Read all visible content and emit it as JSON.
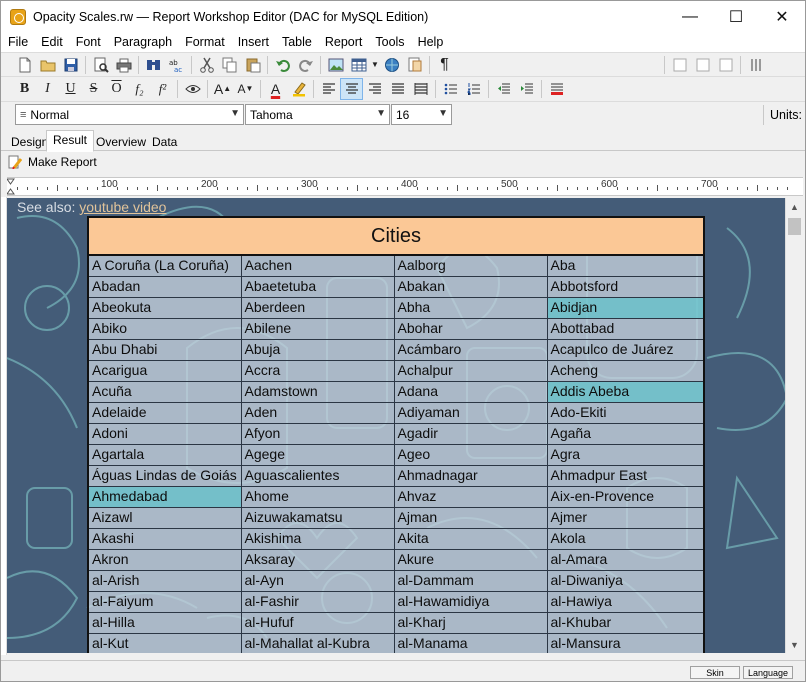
{
  "window": {
    "title": "Opacity Scales.rw — Report Workshop Editor (DAC for MySQL Edition)",
    "controls": {
      "minimize": "—",
      "maximize": "☐",
      "close": "✕"
    }
  },
  "menu": [
    "File",
    "Edit",
    "Font",
    "Paragraph",
    "Format",
    "Insert",
    "Table",
    "Report",
    "Tools",
    "Help"
  ],
  "toolbar1": {
    "icons": [
      "new-document-icon",
      "open-folder-icon",
      "save-icon",
      "print-preview-icon",
      "print-icon",
      "find-icon",
      "spellcheck-icon",
      "cut-icon",
      "copy-icon",
      "paste-icon",
      "undo-icon",
      "redo-icon",
      "insert-picture-icon",
      "insert-table-icon",
      "insert-hyperlink-icon",
      "insert-object-icon",
      "paragraph-marks-icon",
      "page-layout-icon",
      "page-layout2-icon",
      "page-layout3-icon",
      "page-layout4-icon",
      "vertical-text-icon"
    ]
  },
  "toolbar2": {
    "bold": "B",
    "italic": "I",
    "underline": "U",
    "strikethrough": "S",
    "overline": "O",
    "subscript": "f₂",
    "superscript": "f²",
    "font_grow": "A",
    "font_shrink": "A",
    "font_color": "A"
  },
  "formatbar": {
    "style": "Normal",
    "font": "Tahoma",
    "size": "16",
    "units_label": "Units:"
  },
  "tabs": [
    {
      "label": "Design",
      "active": false
    },
    {
      "label": "Result",
      "active": true
    },
    {
      "label": "Overview",
      "active": false
    },
    {
      "label": "Data",
      "active": false
    }
  ],
  "make_report": "Make Report",
  "ruler": {
    "labels": [
      "100",
      "200",
      "300",
      "400",
      "500",
      "600",
      "700"
    ]
  },
  "document": {
    "see_also_prefix": "See also:",
    "see_also_link": "youtube video",
    "background_color": "#445c78",
    "highlight_color": "#78c8d0",
    "table": {
      "title": "Cities",
      "rows": [
        [
          {
            "t": "A Coruña (La Coruña)"
          },
          {
            "t": "Aachen"
          },
          {
            "t": "Aalborg"
          },
          {
            "t": "Aba"
          }
        ],
        [
          {
            "t": "Abadan"
          },
          {
            "t": "Abaetetuba"
          },
          {
            "t": "Abakan"
          },
          {
            "t": "Abbotsford"
          }
        ],
        [
          {
            "t": "Abeokuta"
          },
          {
            "t": "Aberdeen"
          },
          {
            "t": "Abha"
          },
          {
            "t": "Abidjan",
            "hl": true
          }
        ],
        [
          {
            "t": "Abiko"
          },
          {
            "t": "Abilene"
          },
          {
            "t": "Abohar"
          },
          {
            "t": "Abottabad"
          }
        ],
        [
          {
            "t": "Abu Dhabi"
          },
          {
            "t": "Abuja"
          },
          {
            "t": "Acámbaro"
          },
          {
            "t": "Acapulco de Juárez"
          }
        ],
        [
          {
            "t": "Acarigua"
          },
          {
            "t": "Accra"
          },
          {
            "t": "Achalpur"
          },
          {
            "t": "Acheng"
          }
        ],
        [
          {
            "t": "Acuña"
          },
          {
            "t": "Adamstown"
          },
          {
            "t": "Adana"
          },
          {
            "t": "Addis Abeba",
            "hl": true
          }
        ],
        [
          {
            "t": "Adelaide"
          },
          {
            "t": "Aden"
          },
          {
            "t": "Adiyaman"
          },
          {
            "t": "Ado-Ekiti"
          }
        ],
        [
          {
            "t": "Adoni"
          },
          {
            "t": "Afyon"
          },
          {
            "t": "Agadir"
          },
          {
            "t": "Agaña"
          }
        ],
        [
          {
            "t": "Agartala"
          },
          {
            "t": "Agege"
          },
          {
            "t": "Ageo"
          },
          {
            "t": "Agra"
          }
        ],
        [
          {
            "t": "Águas Lindas de Goiás"
          },
          {
            "t": "Aguascalientes"
          },
          {
            "t": "Ahmadnagar"
          },
          {
            "t": "Ahmadpur East"
          }
        ],
        [
          {
            "t": "Ahmedabad",
            "hl": true
          },
          {
            "t": "Ahome"
          },
          {
            "t": "Ahvaz"
          },
          {
            "t": "Aix-en-Provence"
          }
        ],
        [
          {
            "t": "Aizawl"
          },
          {
            "t": "Aizuwakamatsu"
          },
          {
            "t": "Ajman"
          },
          {
            "t": "Ajmer"
          }
        ],
        [
          {
            "t": "Akashi"
          },
          {
            "t": "Akishima"
          },
          {
            "t": "Akita"
          },
          {
            "t": "Akola"
          }
        ],
        [
          {
            "t": "Akron"
          },
          {
            "t": "Aksaray"
          },
          {
            "t": "Akure"
          },
          {
            "t": "al-Amara"
          }
        ],
        [
          {
            "t": "al-Arish"
          },
          {
            "t": "al-Ayn"
          },
          {
            "t": "al-Dammam"
          },
          {
            "t": "al-Diwaniya"
          }
        ],
        [
          {
            "t": "al-Faiyum"
          },
          {
            "t": "al-Fashir"
          },
          {
            "t": "al-Hawamidiya"
          },
          {
            "t": "al-Hawiya"
          }
        ],
        [
          {
            "t": "al-Hilla"
          },
          {
            "t": "al-Hufuf"
          },
          {
            "t": "al-Kharj"
          },
          {
            "t": "al-Khubar"
          }
        ],
        [
          {
            "t": "al-Kut"
          },
          {
            "t": "al-Mahallat al-Kubra"
          },
          {
            "t": "al-Manama"
          },
          {
            "t": "al-Mansura"
          }
        ]
      ]
    }
  },
  "status": {
    "skin": "Skin",
    "language": "Language"
  }
}
